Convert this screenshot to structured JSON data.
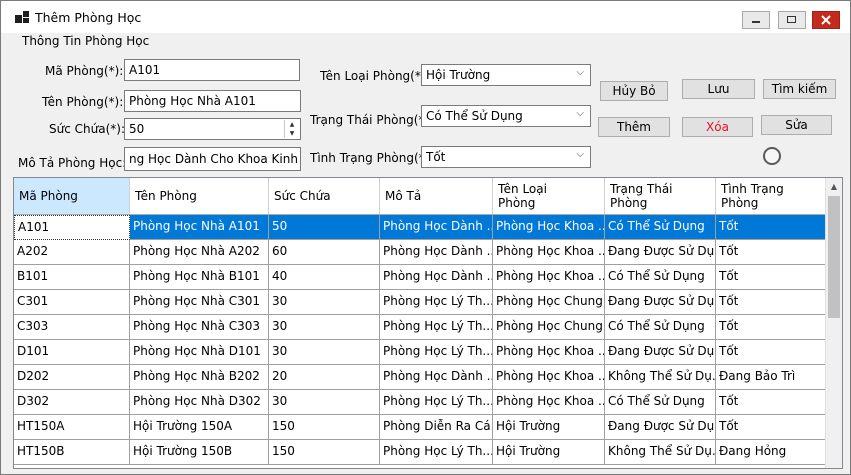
{
  "window": {
    "title": "Thêm Phòng Học"
  },
  "group_label": "Thông Tin Phòng Học",
  "form": {
    "ma_phong": {
      "label": "Mã Phòng(*):",
      "value": "A101"
    },
    "ten_phong": {
      "label": "Tên Phòng(*):",
      "value": "Phòng Học Nhà A101"
    },
    "suc_chua": {
      "label": "Sức Chứa(*):",
      "value": "50"
    },
    "mo_ta": {
      "label": "Mô Tả Phòng Học:",
      "value": "ng Học Dành Cho Khoa Kinh Tế"
    },
    "ten_loai_phong": {
      "label": "Tên Loại Phòng(*):",
      "value": "Hội Trường"
    },
    "trang_thai_phong": {
      "label": "Trạng Thái Phòng(*):",
      "value": "Có Thể Sử Dụng"
    },
    "tinh_trang_phong": {
      "label": "Tình Trạng Phòng(*):",
      "value": "Tốt"
    }
  },
  "buttons": {
    "huy_bo": "Hủy Bỏ",
    "luu": "Lưu",
    "tim_kiem": "Tìm kiếm",
    "them": "Thêm",
    "xoa": "Xóa",
    "sua": "Sửa"
  },
  "colors": {
    "selection": "#0078d7",
    "delete_text": "#e81123",
    "header_selected": "#cce8ff"
  },
  "table": {
    "headers": [
      {
        "l1": "Mã Phòng",
        "l2": ""
      },
      {
        "l1": "Tên Phòng",
        "l2": ""
      },
      {
        "l1": "Sức Chứa",
        "l2": ""
      },
      {
        "l1": "Mô Tả",
        "l2": ""
      },
      {
        "l1": "Tên Loại",
        "l2": "Phòng"
      },
      {
        "l1": "Trạng Thái",
        "l2": "Phòng"
      },
      {
        "l1": "Tình Trạng",
        "l2": "Phòng"
      }
    ],
    "rows": [
      [
        "A101",
        "Phòng Học Nhà A101",
        "50",
        "Phòng Học Dành ...",
        "Phòng Học Khoa ...",
        "Có Thể Sử Dụng",
        "Tốt"
      ],
      [
        "A202",
        "Phòng Học Nhà A202",
        "60",
        "Phòng Học Dành ...",
        "Phòng Học Khoa ...",
        "Đang Được Sử Dụ...",
        "Tốt"
      ],
      [
        "B101",
        "Phòng Học Nhà B101",
        "40",
        "Phòng Học Dành ...",
        "Phòng Học Khoa ...",
        "Có Thể Sử Dụng",
        "Tốt"
      ],
      [
        "C301",
        "Phòng Học Nhà C301",
        "30",
        "Phòng Học Lý Th...",
        "Phòng Học Chung",
        "Đang Được Sử Dụ...",
        "Tốt"
      ],
      [
        "C303",
        "Phòng Học Nhà C303",
        "30",
        "Phòng Học Lý Th...",
        "Phòng Học Chung",
        "Có Thể Sử Dụng",
        "Tốt"
      ],
      [
        "D101",
        "Phòng Học Nhà D101",
        "30",
        "Phòng Học Lý Th...",
        "Phòng Học Khoa ...",
        "Đang Được Sử Dụ...",
        "Tốt"
      ],
      [
        "D202",
        "Phòng Học Nhà B202",
        "20",
        "Phòng Học Dành ...",
        "Phòng Học Khoa ...",
        "Không Thể Sử Dụ...",
        "Đang Bảo Trì"
      ],
      [
        "D302",
        "Phòng Học Nhà D302",
        "30",
        "Phòng Học Lý Th...",
        "Phòng Học Khoa ...",
        "Có Thể Sử Dụng",
        "Tốt"
      ],
      [
        "HT150A",
        "Hội Trường 150A",
        "150",
        "Phòng Diễn Ra Cá...",
        "Hội Trường",
        "Đang Được Sử Dụ...",
        "Tốt"
      ],
      [
        "HT150B",
        "Hội Trường 150B",
        "150",
        "Phòng Học Lý Th...",
        "Hội Trường",
        "Không Thể Sử Dụ...",
        "Đang Hỏng"
      ]
    ]
  }
}
